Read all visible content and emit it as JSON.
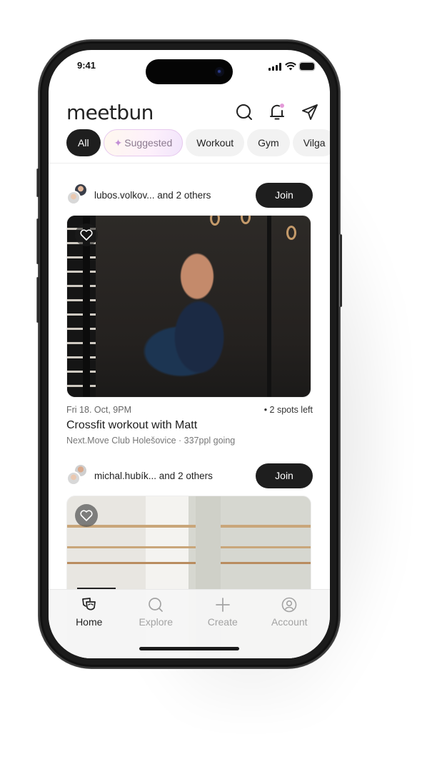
{
  "status_bar": {
    "time": "9:41"
  },
  "header": {
    "logo": "meetbun",
    "icons": [
      "search-icon",
      "bell-icon",
      "send-icon"
    ],
    "notification_dot_color": "#e39ad8"
  },
  "filters": {
    "chips": [
      {
        "label": "All",
        "active": true
      },
      {
        "label": "Suggested",
        "icon": "sparkle-icon"
      },
      {
        "label": "Workout"
      },
      {
        "label": "Gym"
      },
      {
        "label": "Vilga"
      }
    ]
  },
  "posts": [
    {
      "attendees": "lubos.volkov... and 2 others",
      "join_label": "Join",
      "image": "woman doing kettlebell squat in dark gym",
      "date": "Fri 18. Oct, 9PM",
      "spots": "• 2 spots left",
      "title": "Crossfit workout with Matt",
      "subtitle": "Next.Move Club Holešovice · 337ppl going"
    },
    {
      "attendees": "michal.hubík... and 2 others",
      "join_label": "Join",
      "image": "bright cafe interior with shelves and plants"
    }
  ],
  "tabbar": {
    "tabs": [
      {
        "label": "Home",
        "icon": "home-mask-icon",
        "active": true
      },
      {
        "label": "Explore",
        "icon": "search-icon"
      },
      {
        "label": "Create",
        "icon": "plus-icon"
      },
      {
        "label": "Account",
        "icon": "account-icon"
      }
    ]
  },
  "colors": {
    "primary": "#1e1e1e",
    "accent": "#c38fd6"
  }
}
